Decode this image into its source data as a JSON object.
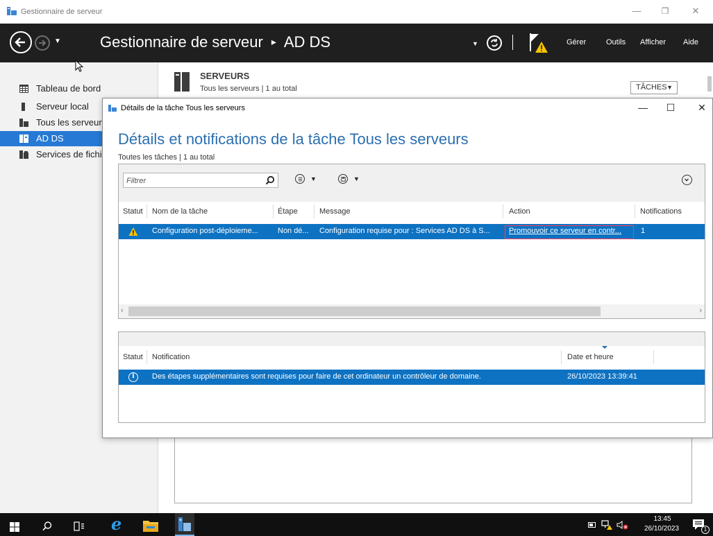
{
  "window": {
    "title": "Gestionnaire de serveur",
    "controls": [
      "minimize",
      "restore",
      "close"
    ]
  },
  "header": {
    "title": "Gestionnaire de serveur",
    "breadcrumb_separator": "▸",
    "breadcrumb_current": "AD DS",
    "menu": [
      "Gérer",
      "Outils",
      "Afficher",
      "Aide"
    ],
    "icons": [
      "back-arrow-icon",
      "forward-arrow-icon",
      "refresh-icon",
      "notification-flag-warning-icon"
    ]
  },
  "sidebar": {
    "items": [
      {
        "label": "Tableau de bord",
        "icon": "dashboard-icon",
        "active": false
      },
      {
        "label": "Serveur local",
        "icon": "server-icon",
        "active": false
      },
      {
        "label": "Tous les serveurs",
        "icon": "servers-icon",
        "active": false
      },
      {
        "label": "AD DS",
        "icon": "adds-icon",
        "active": true
      },
      {
        "label": "Services de fichiers et de stockage",
        "icon": "file-services-icon",
        "active": false
      }
    ]
  },
  "main": {
    "servers_title": "SERVEURS",
    "servers_subtitle": "Tous les serveurs | 1 au total",
    "tasks_button": "TÂCHES"
  },
  "dialog": {
    "title": "Détails de la tâche Tous les serveurs",
    "heading": "Détails et notifications de la tâche Tous les serveurs",
    "subheading": "Toutes les tâches | 1 au total",
    "filter_placeholder": "Filtrer",
    "tasks_table": {
      "columns": [
        "Statut",
        "Nom de la tâche",
        "Étape",
        "Message",
        "Action",
        "Notifications"
      ],
      "rows": [
        {
          "status_icon": "warning-icon",
          "name": "Configuration post-déploieme...",
          "stage": "Non dé...",
          "message": "Configuration requise pour : Services AD DS à S...",
          "action": "Promouvoir ce serveur en contr...",
          "notifications": "1"
        }
      ]
    },
    "notifications_table": {
      "columns": [
        "Statut",
        "Notification",
        "Date et heure"
      ],
      "rows": [
        {
          "status_icon": "info-icon",
          "notification": "Des étapes supplémentaires sont requises pour faire de cet ordinateur un contrôleur de domaine.",
          "datetime": "26/10/2023 13:39:41"
        }
      ]
    }
  },
  "taskbar": {
    "time": "13:45",
    "date": "26/10/2023",
    "notification_count": "1",
    "icons": [
      "start-icon",
      "search-icon",
      "task-view-icon",
      "internet-explorer-icon",
      "file-explorer-icon",
      "server-manager-icon"
    ]
  },
  "colors": {
    "accent": "#2679d4",
    "selection": "#0e72c2",
    "header_bg": "#1f1f1f",
    "heading_blue": "#2b6fb0",
    "warning": "#f5c400"
  }
}
